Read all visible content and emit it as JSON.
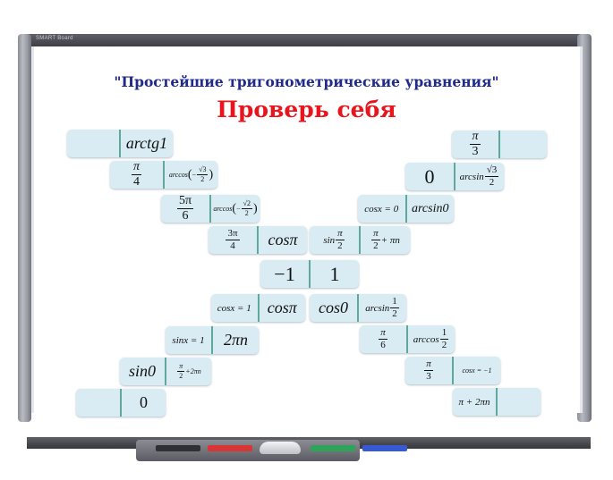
{
  "board": {
    "logo": "SMART Board",
    "subtitle": "\"Простейшие тригонометрические уравнения\"",
    "title": "Проверь себя"
  },
  "tray": {
    "pens": [
      "black",
      "red",
      "green",
      "blue"
    ],
    "pen_colors": [
      "#2f3035",
      "#d93535",
      "#2ea35a",
      "#3759d4"
    ]
  },
  "cards": [
    {
      "left": "",
      "right": "arctg1"
    },
    {
      "left": "π/4",
      "right": "arccos(−√3/2)"
    },
    {
      "left": "5π/6",
      "right": "arccos(−√2/2)"
    },
    {
      "left": "3π/4",
      "right": "cosπ"
    },
    {
      "left": "−1",
      "right": "1"
    },
    {
      "left": "cosx = 1",
      "right": "cosπ"
    },
    {
      "left": "sinx = 1",
      "right": "2πn"
    },
    {
      "left": "sin0",
      "right": "π/2 + 2πn"
    },
    {
      "left": "",
      "right": "0"
    },
    {
      "left": "π/3",
      "right": ""
    },
    {
      "left": "0",
      "right": "arcsin √3/2"
    },
    {
      "left": "cosx = 0",
      "right": "arcsin0"
    },
    {
      "left": "sin π/2",
      "right": "π/2 + πn"
    },
    {
      "left": "cos0",
      "right": "arcsin 1/2"
    },
    {
      "left": "π/6",
      "right": "arccos 1/2"
    },
    {
      "left": "π/3",
      "right": "cosx = −1"
    },
    {
      "left": "π + 2πn",
      "right": ""
    }
  ],
  "glyphs": {
    "pi": "π",
    "sqrt3": "√3",
    "sqrt2": "√2",
    "minus": "−",
    "two": "2",
    "three": "3",
    "four": "4",
    "six": "6",
    "one": "1",
    "five_pi": "5π",
    "three_pi": "3π",
    "arccos": "arccos",
    "arcsin": "arcsin",
    "sin": "sin",
    "plus_pi_n": "+ πn",
    "plus_2pi_n": "+2πn",
    "lparen": "(",
    "rparen": ")"
  }
}
